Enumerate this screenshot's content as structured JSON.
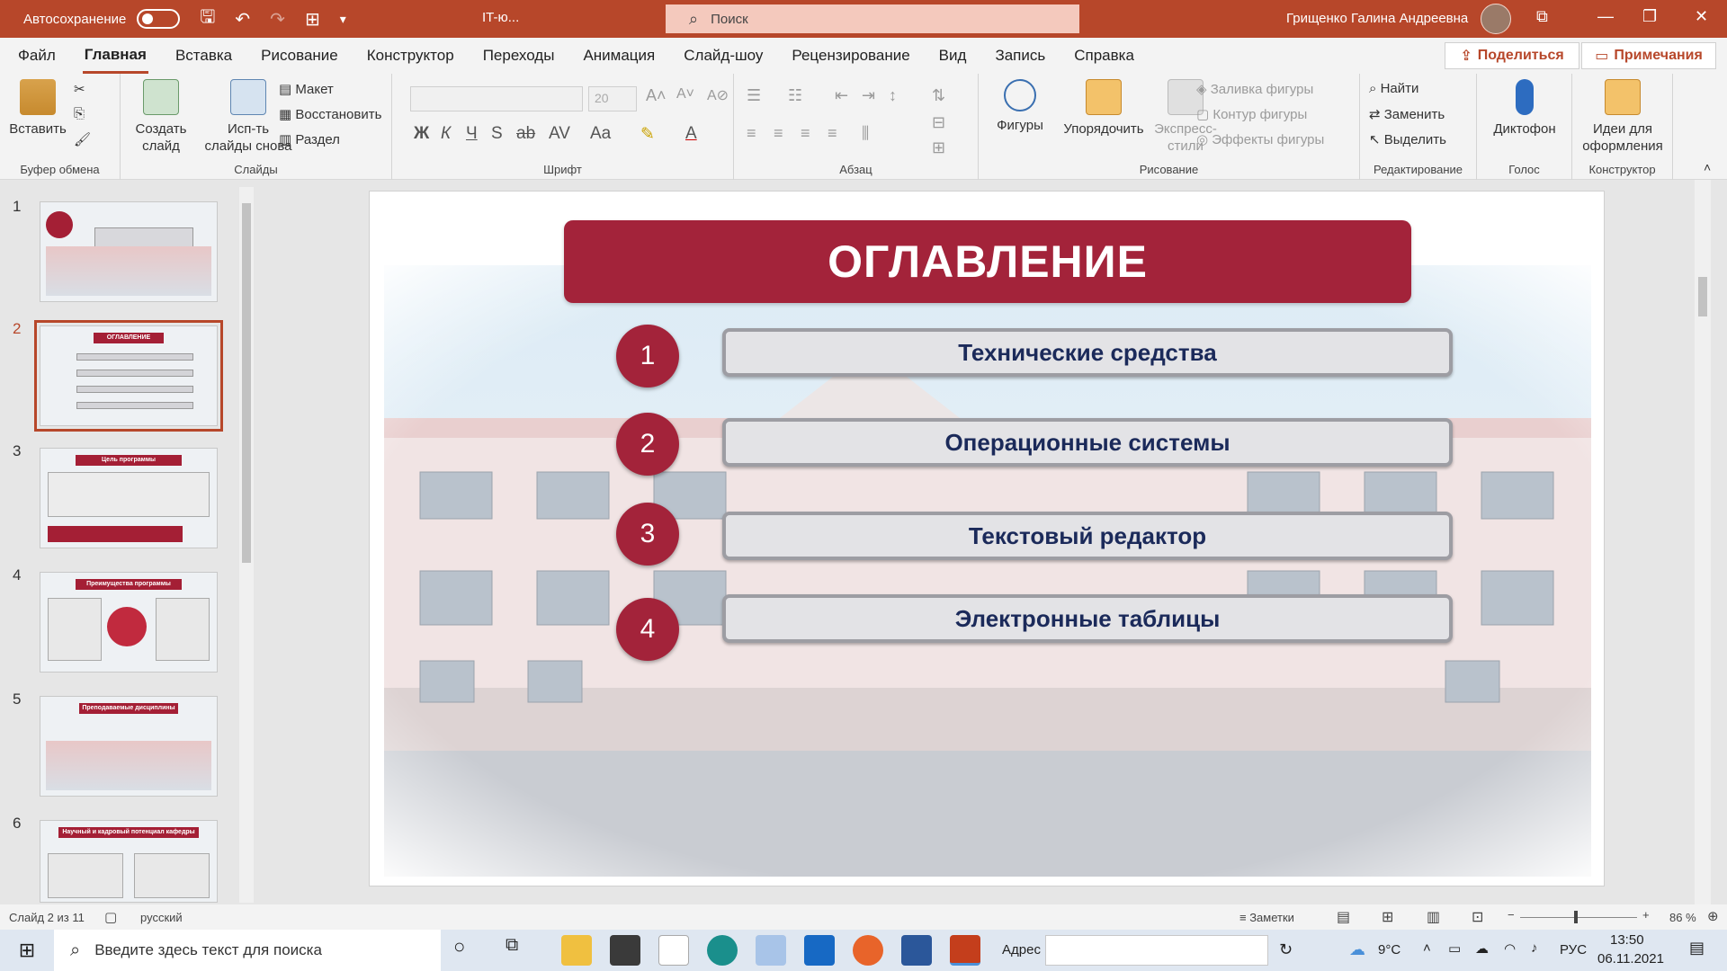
{
  "titlebar": {
    "autosave_label": "Автосохранение",
    "doc_title": "IT-ю...",
    "search_placeholder": "Поиск",
    "user_name": "Грищенко Галина Андреевна"
  },
  "menu": {
    "tabs": [
      "Файл",
      "Главная",
      "Вставка",
      "Рисование",
      "Конструктор",
      "Переходы",
      "Анимация",
      "Слайд-шоу",
      "Рецензирование",
      "Вид",
      "Запись",
      "Справка"
    ],
    "active_index": 1,
    "share_label": "Поделиться",
    "comments_label": "Примечания"
  },
  "ribbon": {
    "clipboard": {
      "paste": "Вставить",
      "group": "Буфер обмена"
    },
    "slides": {
      "new_slide_1": "Создать",
      "new_slide_2": "слайд",
      "reuse_1": "Исп-ть",
      "reuse_2": "слайды снова",
      "layout": "Макет",
      "reset": "Восстановить",
      "section": "Раздел",
      "group": "Слайды"
    },
    "font": {
      "group": "Шрифт",
      "size": "20"
    },
    "paragraph": {
      "group": "Абзац"
    },
    "drawing": {
      "shapes": "Фигуры",
      "arrange": "Упорядочить",
      "quick_1": "Экспресс-",
      "quick_2": "стили",
      "fill": "Заливка фигуры",
      "outline": "Контур фигуры",
      "effects": "Эффекты фигуры",
      "group": "Рисование"
    },
    "editing": {
      "find": "Найти",
      "replace": "Заменить",
      "select": "Выделить",
      "group": "Редактирование"
    },
    "voice": {
      "dictate": "Диктофон",
      "group": "Голос"
    },
    "designer": {
      "ideas_1": "Идеи для",
      "ideas_2": "оформления",
      "group": "Конструктор"
    }
  },
  "thumbnails": [
    {
      "num": "1",
      "title": ""
    },
    {
      "num": "2",
      "title": "ОГЛАВЛЕНИЕ"
    },
    {
      "num": "3",
      "title": "Цель программы"
    },
    {
      "num": "4",
      "title": "Преимущества программы"
    },
    {
      "num": "5",
      "title": "Преподаваемые дисциплины"
    },
    {
      "num": "6",
      "title": "Научный и кадровый потенциал кафедры"
    }
  ],
  "slide": {
    "title": "ОГЛАВЛЕНИЕ",
    "items": [
      {
        "num": "1",
        "text": "Технические средства"
      },
      {
        "num": "2",
        "text": "Операционные системы"
      },
      {
        "num": "3",
        "text": "Текстовый редактор"
      },
      {
        "num": "4",
        "text": "Электронные таблицы"
      }
    ]
  },
  "status": {
    "slide_counter": "Слайд 2 из 11",
    "language": "русский",
    "notes": "Заметки",
    "zoom": "86 %"
  },
  "taskbar": {
    "search_placeholder": "Введите здесь текст для поиска",
    "address_label": "Адрес",
    "weather": "9°C",
    "lang": "РУС",
    "time": "13:50",
    "date": "06.11.2021"
  },
  "colors": {
    "accent": "#b7472a",
    "slide_red": "#a3233a",
    "item_text": "#1b2a5a"
  }
}
